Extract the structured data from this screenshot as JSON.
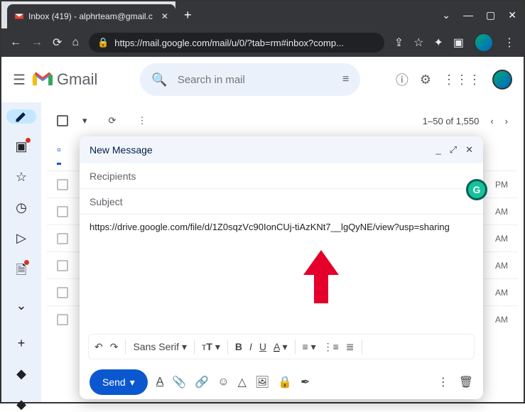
{
  "browser": {
    "tab_title": "Inbox (419) - alphrteam@gmail.c",
    "url": "https://mail.google.com/mail/u/0/?tab=rm#inbox?comp..."
  },
  "header": {
    "product": "Gmail",
    "search_placeholder": "Search in mail"
  },
  "toolbar": {
    "page_info": "1–50 of 1,550"
  },
  "compose": {
    "title": "New Message",
    "recipients_placeholder": "Recipients",
    "subject_placeholder": "Subject",
    "body": "https://drive.google.com/file/d/1Z0sqzVc90IonCUj-tiAzKNt7__lgQyNE/view?usp=sharing",
    "font": "Sans Serif",
    "send_label": "Send"
  },
  "rows": {
    "t0": "PM",
    "t1": "AM",
    "t2": "AM",
    "t3": "AM",
    "t4": "AM",
    "t5": "AM"
  }
}
